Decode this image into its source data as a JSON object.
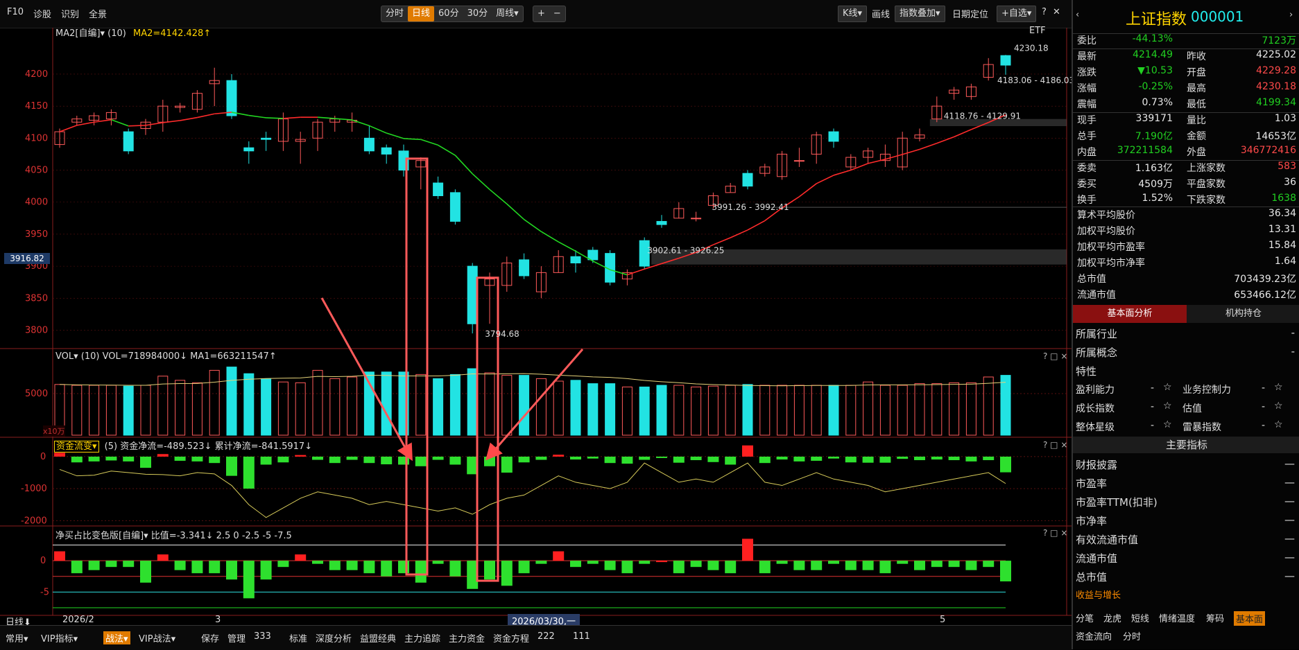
{
  "toolbar": {
    "f10": "F10",
    "diagnose": "诊股",
    "recognize": "识别",
    "fullscreen": "全景",
    "periods": [
      "分时",
      "日线",
      "60分",
      "30分",
      "周线▾"
    ],
    "active_period": "日线",
    "zoom_in": "+",
    "zoom_out": "−",
    "kline": "K线▾",
    "draw": "画线",
    "index_overlay": "指数叠加▾",
    "date_locate": "日期定位",
    "watchlist": "+自选▾",
    "help": "?",
    "close": "✕",
    "expand": "K"
  },
  "main_chart": {
    "indicator_label": "MA2[自编]▾ (10)",
    "ma2_label": "MA2=4142.428↑",
    "etf_label": "ETF",
    "price_readout": "3916.82",
    "y_ticks": [
      "4200",
      "4150",
      "4100",
      "4050",
      "4000",
      "3950",
      "3900",
      "3850",
      "3800"
    ],
    "annotations": [
      "4230.18",
      "4183.06 - 4186.03",
      "4118.76 - 4129.91",
      "3991.26 - 3992.41",
      "3902.61 - 3926.25",
      "3794.68"
    ]
  },
  "vol_panel": {
    "label": "VOL▾ (10) VOL=718984000↓ MA1=663211547↑",
    "y_ticks": [
      "5000"
    ],
    "unit": "x10万",
    "controls": "? □ ×"
  },
  "flow_panel": {
    "name": "资金流变▾",
    "label": "(5) 资金净流=-489.523↓ 累计净流=-841.5917↓",
    "y_ticks": [
      "0",
      "-1000",
      "-2000"
    ],
    "controls": "? □ ×"
  },
  "ratio_panel": {
    "label": "净买占比变色版[自编]▾ 比值=-3.341↓ 2.5 0 -2.5 -5 -7.5",
    "y_ticks": [
      "0",
      "-5"
    ],
    "controls": "? □ ×"
  },
  "date_axis": {
    "mode": "日线⬇",
    "labels": [
      "2026/2",
      "3",
      "5"
    ],
    "cursor": "2026/03/30,一"
  },
  "bottom_tabs": [
    "常用▾",
    "VIP指标▾",
    "战法▾",
    "VIP战法▾",
    "保存",
    "管理",
    "333",
    "标准",
    "深度分析",
    "益盟经典",
    "主力追踪",
    "主力资金",
    "资金方程",
    "222",
    "111"
  ],
  "active_bottom_tab": "战法▾",
  "quote": {
    "name": "上证指数",
    "code": "000001",
    "rows": [
      {
        "l1": "委比",
        "v1": "-44.13%",
        "c1": "green",
        "l2": "",
        "v2": "7123万",
        "c2": "green"
      },
      {
        "l1": "最新",
        "v1": "4214.49",
        "c1": "green",
        "l2": "昨收",
        "v2": "4225.02",
        "c2": "white"
      },
      {
        "l1": "涨跌",
        "v1": "▼10.53",
        "c1": "green",
        "l2": "开盘",
        "v2": "4229.28",
        "c2": "red"
      },
      {
        "l1": "涨幅",
        "v1": "-0.25%",
        "c1": "green",
        "l2": "最高",
        "v2": "4230.18",
        "c2": "red"
      },
      {
        "l1": "震幅",
        "v1": "0.73%",
        "c1": "white",
        "l2": "最低",
        "v2": "4199.34",
        "c2": "green"
      },
      {
        "l1": "现手",
        "v1": "339171",
        "c1": "white",
        "l2": "量比",
        "v2": "1.03",
        "c2": "white"
      },
      {
        "l1": "总手",
        "v1": "7.190亿",
        "c1": "green",
        "l2": "金额",
        "v2": "14653亿",
        "c2": "white"
      },
      {
        "l1": "内盘",
        "v1": "372211584",
        "c1": "green",
        "l2": "外盘",
        "v2": "346772416",
        "c2": "red"
      },
      {
        "l1": "委卖",
        "v1": "1.163亿",
        "c1": "white",
        "l2": "上涨家数",
        "v2": "583",
        "c2": "red"
      },
      {
        "l1": "委买",
        "v1": "4509万",
        "c1": "white",
        "l2": "平盘家数",
        "v2": "36",
        "c2": "white"
      },
      {
        "l1": "换手",
        "v1": "1.52%",
        "c1": "white",
        "l2": "下跌家数",
        "v2": "1638",
        "c2": "green"
      }
    ],
    "stats": [
      {
        "label": "算术平均股价",
        "value": "36.34"
      },
      {
        "label": "加权平均股价",
        "value": "13.31"
      },
      {
        "label": "加权平均市盈率",
        "value": "15.84"
      },
      {
        "label": "加权平均市净率",
        "value": "1.64"
      },
      {
        "label": "总市值",
        "value": "703439.23亿"
      },
      {
        "label": "流通市值",
        "value": "653466.12亿"
      }
    ]
  },
  "fund_tabs": [
    "基本面分析",
    "机构持仓"
  ],
  "fundamentals": {
    "industry": "所属行业",
    "concept": "所属概念",
    "traits": "特性",
    "dash": "-",
    "pairs": [
      {
        "a": "盈利能力",
        "b": "业务控制力"
      },
      {
        "a": "成长指数",
        "b": "估值"
      },
      {
        "a": "整体星级",
        "b": "雷暴指数"
      }
    ],
    "main_title": "主要指标",
    "metrics": [
      "财报披露",
      "市盈率",
      "市盈率TTM(扣非)",
      "市净率",
      "有效流通市值",
      "流通市值",
      "总市值"
    ],
    "metric_value": "—",
    "growth": "收益与增长"
  },
  "right_bottom_tabs": [
    "分笔",
    "龙虎",
    "短线",
    "情绪温度",
    "筹码",
    "基本面"
  ],
  "right_bottom_tabs2": [
    "资金流向",
    "分时"
  ],
  "active_right_tab": "基本面"
}
